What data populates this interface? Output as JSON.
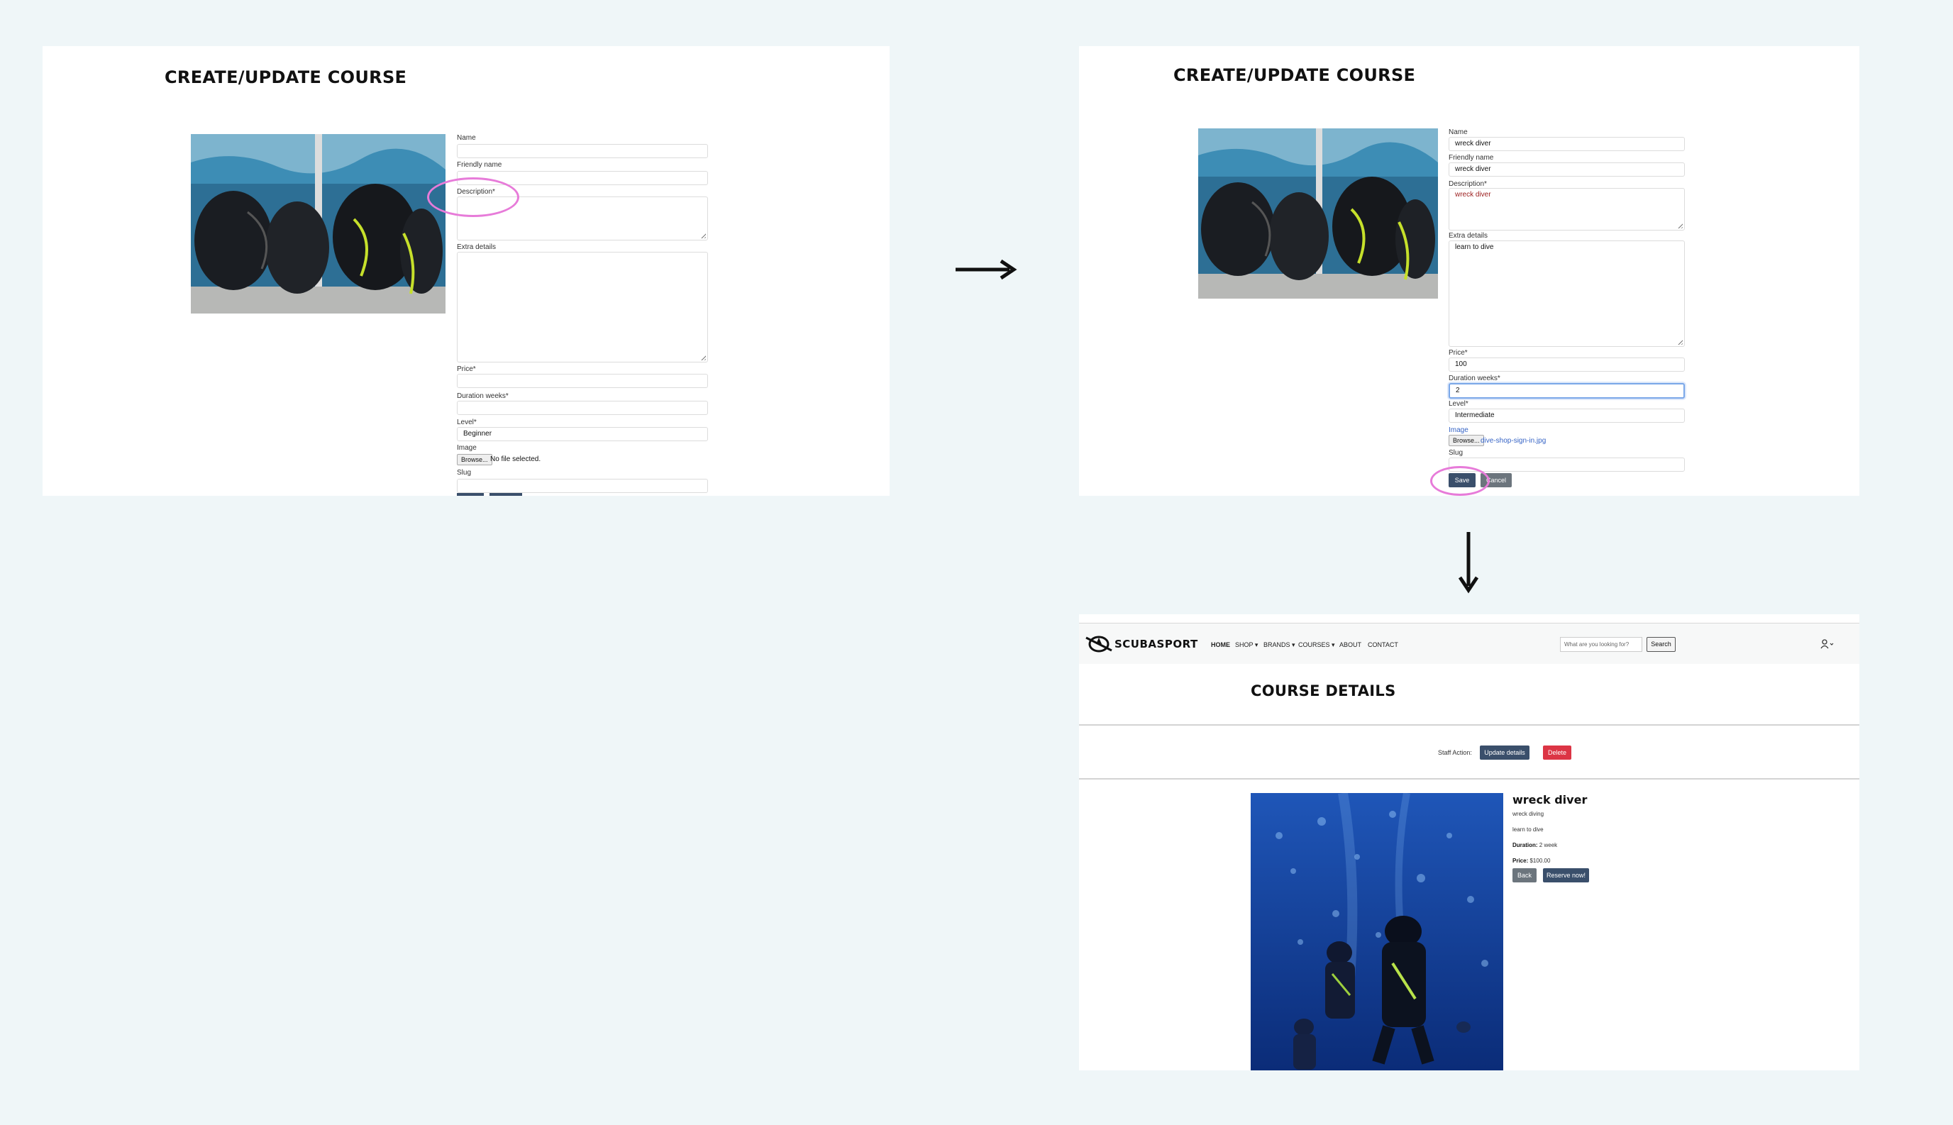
{
  "panel_a": {
    "title": "CREATE/UPDATE COURSE",
    "labels": {
      "name": "Name",
      "friendly_name": "Friendly name",
      "description": "Description*",
      "extra_details": "Extra details",
      "price": "Price*",
      "duration": "Duration weeks*",
      "level": "Level*",
      "image": "Image",
      "slug": "Slug"
    },
    "values": {
      "level": "Beginner"
    },
    "browse_label": "Browse...",
    "file_status": "No file selected."
  },
  "panel_b": {
    "title": "CREATE/UPDATE COURSE",
    "labels": {
      "name": "Name",
      "friendly_name": "Friendly name",
      "description": "Description*",
      "extra_details": "Extra details",
      "price": "Price*",
      "duration": "Duration weeks*",
      "level": "Level*",
      "image": "Image",
      "slug": "Slug"
    },
    "values": {
      "name": "wreck diver",
      "friendly_name": "wreck diver",
      "description": "wreck diver",
      "extra_details": "learn to dive",
      "price": "100",
      "duration": "2",
      "level": "Intermediate"
    },
    "browse_label": "Browse...",
    "file_name": "dive-shop-sign-in.jpg",
    "save_label": "Save",
    "cancel_label": "Cancel"
  },
  "panel_c": {
    "brand": "SCUBASPORT",
    "nav": [
      "HOME",
      "SHOP ▾",
      "BRANDS ▾",
      "COURSES ▾",
      "ABOUT",
      "CONTACT"
    ],
    "search_placeholder": "What are you looking for?",
    "search_label": "Search",
    "page_title": "COURSE DETAILS",
    "staff_action_label": "Staff Action:",
    "update_label": "Update details",
    "delete_label": "Delete",
    "course_name": "wreck diver",
    "friendly_text": "wreck diving",
    "extra_text": "learn to dive",
    "duration_label": "Duration:",
    "duration_value": "2 week",
    "price_label": "Price:",
    "price_value": "$100.00",
    "back_label": "Back",
    "reserve_label": "Reserve now!"
  },
  "colors": {
    "background": "#eff6f8",
    "navy_button": "#3a4f6b",
    "delete_button": "#dc3545",
    "highlight_ring": "#e77bd9"
  }
}
